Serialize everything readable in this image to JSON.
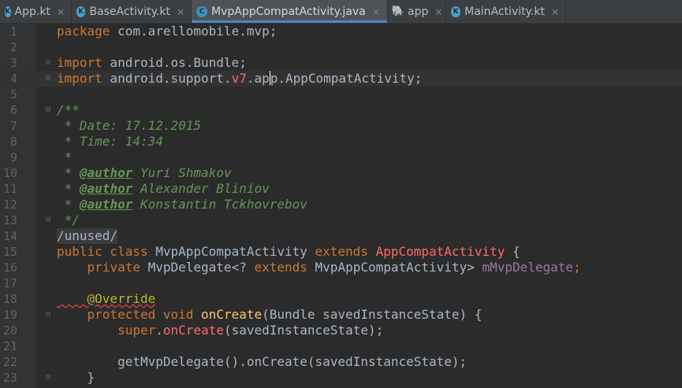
{
  "tabs": [
    {
      "label": "App.kt",
      "icon": "kotlin-file-icon",
      "glyph": "K",
      "active": false
    },
    {
      "label": "BaseActivity.kt",
      "icon": "kotlin-file-icon",
      "glyph": "K",
      "active": false
    },
    {
      "label": "MvpAppCompatActivity.java",
      "icon": "java-class-icon",
      "glyph": "C",
      "active": true
    },
    {
      "label": "app",
      "icon": "gradle-elephant-icon",
      "glyph": "🐘",
      "active": false
    },
    {
      "label": "MainActivity.kt",
      "icon": "kotlin-file-icon",
      "glyph": "K",
      "active": false
    }
  ],
  "close_glyph": "×",
  "lines": [
    "1",
    "2",
    "3",
    "4",
    "5",
    "6",
    "7",
    "8",
    "9",
    "10",
    "11",
    "12",
    "13",
    "14",
    "15",
    "16",
    "17",
    "18",
    "19",
    "20",
    "21",
    "22",
    "23"
  ],
  "code": {
    "l1_kw": "package",
    "l1_rest": " com.arellomobile.mvp;",
    "l3_kw": "import",
    "l3_rest": " android.os.Bundle;",
    "l4_kw": "import",
    "l4_a": " android.support.",
    "l4_err": "v7",
    "l4_b": ".ap",
    "l4_c": "p.AppCompatActivity;",
    "l6": "/**",
    "l7": " * Date: 17.12.2015",
    "l8": " * Time: 14:34",
    "l9": " *",
    "l10_star": " * ",
    "l10_tag": "@author",
    "l10_name": " Yuri Shmakov",
    "l11_star": " * ",
    "l11_tag": "@author",
    "l11_name": " Alexander Bliniov",
    "l12_star": " * ",
    "l12_tag": "@author",
    "l12_name": " Konstantin Tckhovrebov",
    "l13": " */",
    "l14": "/unused/",
    "l15_kw": "public class",
    "l15_a": " MvpAppCompatActivity ",
    "l15_kw2": "extends",
    "l15_err": " AppCompatActivity",
    "l15_b": " {",
    "l16_kw": "    private",
    "l16_a": " MvpDelegate<? ",
    "l16_kw2": "extends",
    "l16_b": " MvpAppCompatActivity> ",
    "l16_field": "mMvpDelegate",
    "l16_c": ";",
    "l18_ann": "    @Override",
    "l19_kw": "    protected void",
    "l19_fn": " onCreate",
    "l19_a": "(Bundle savedInstanceState) {",
    "l20_kw": "        super",
    "l20_dot": ".",
    "l20_err": "onCreate",
    "l20_a": "(savedInstanceState);",
    "l22": "        getMvpDelegate().onCreate(savedInstanceState);",
    "l23": "    }"
  }
}
